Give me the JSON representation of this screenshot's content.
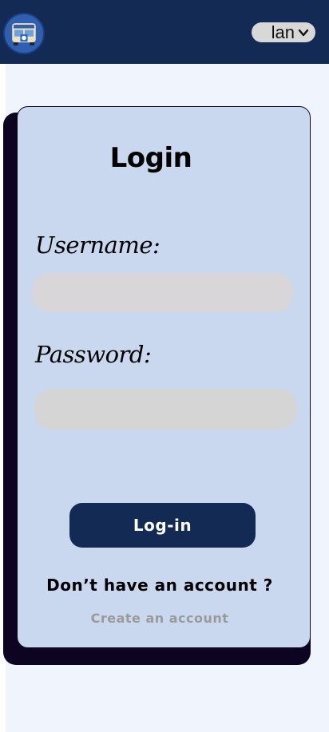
{
  "header": {
    "logo_icon": "bus-logo-icon",
    "language": {
      "selected": "lan",
      "icon": "chevron-down-icon"
    },
    "colors": {
      "bar": "#132a55"
    }
  },
  "login": {
    "title": "Login",
    "username_label": "Username:",
    "username_value": "",
    "username_placeholder": "",
    "password_label": "Password:",
    "password_value": "",
    "password_placeholder": "",
    "submit_label": "Log-in",
    "no_account_text": "Don’t have an account ?",
    "create_account_label": "Create an account"
  },
  "colors": {
    "card": "#c9d8ef",
    "card_shadow": "#0c0420",
    "button": "#132a55",
    "link": "#9a9a9a",
    "page": "#f0f4fd"
  }
}
